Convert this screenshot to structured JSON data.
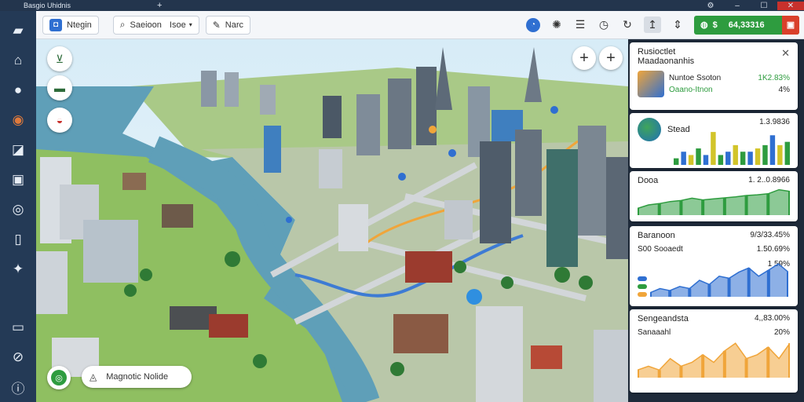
{
  "window": {
    "title": "Basgio Uhidnis",
    "new_tab": "+"
  },
  "toolbar": {
    "app_label": "Ntegin",
    "search_label": "Saeioon",
    "filter_label": "Isoe",
    "route_label": "Narc",
    "balance": "64,33316"
  },
  "map": {
    "search_chip": "Magnotic Nolide"
  },
  "panel": {
    "summary": {
      "title_line1": "Rusioctlet",
      "title_line2": "Maadaonanhis",
      "row1_label": "Nuntoe Ssoton",
      "row1_value": "1K2.83%",
      "row2_label": "Oaano-Itnon",
      "row2_value": "4%"
    },
    "card2": {
      "label": "Stead",
      "value": "1.3.9836"
    },
    "card3": {
      "label": "Dooa",
      "value": "1. 2..0.8966"
    },
    "card4": {
      "label": "Baranoon",
      "value": "9/3/33.45%",
      "row1_label": "S00 Sooaedt",
      "row1_value": "1.50.69%",
      "row2_value": "1 59%"
    },
    "card5": {
      "label": "Sengeandsta",
      "value": "4,,83.00%",
      "row1_label": "Sanaaahl",
      "row1_value": "20%"
    }
  },
  "chart_data": [
    {
      "type": "bar",
      "colors": [
        "#2e9c3f",
        "#2f6fd1",
        "#d2c42a"
      ],
      "values": [
        2,
        4,
        3,
        5,
        3,
        10,
        3,
        4,
        6,
        4,
        4,
        5,
        6,
        9,
        6,
        7
      ]
    },
    {
      "type": "area",
      "colors": [
        "#2e9c3f"
      ],
      "values": [
        2,
        3,
        3.4,
        4,
        4.3,
        5,
        4.5,
        4.8,
        5.1,
        5.4,
        5.8,
        6,
        6.3,
        7.5,
        7
      ]
    },
    {
      "type": "area",
      "colors": [
        "#2f6fd1"
      ],
      "values": [
        1,
        2,
        1.5,
        2.5,
        2,
        4,
        3,
        5,
        4.5,
        6,
        7,
        5,
        6.5,
        8,
        6
      ]
    },
    {
      "type": "area",
      "colors": [
        "#f0a53a"
      ],
      "values": [
        2,
        3,
        2,
        5,
        3,
        4,
        6,
        4,
        7,
        9,
        5,
        6,
        8,
        5,
        9
      ]
    }
  ]
}
